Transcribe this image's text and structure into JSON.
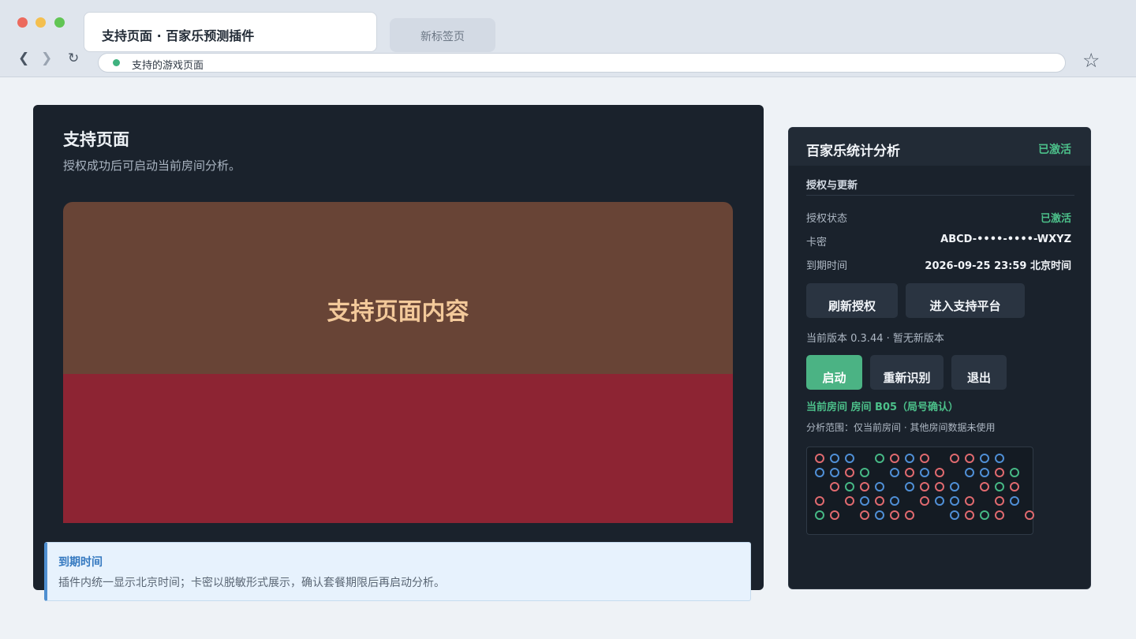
{
  "browser": {
    "active_tab": "支持页面 · 百家乐预测插件",
    "inactive_tab": "新标签页",
    "back_glyph": "❮",
    "forward_glyph": "❯",
    "reload_glyph": "↻",
    "address": "支持的游戏页面",
    "star_glyph": "☆"
  },
  "main": {
    "title": "支持页面",
    "subtitle": "授权成功后可启动当前房间分析。",
    "content_label": "支持页面内容"
  },
  "notice": {
    "title": "到期时间",
    "text": "插件内统一显示北京时间；卡密以脱敏形式展示，确认套餐期限后再启动分析。"
  },
  "plugin": {
    "title": "百家乐统计分析",
    "status": "已激活",
    "section_title": "授权与更新",
    "rows": [
      {
        "key": "授权状态",
        "value": "已激活"
      },
      {
        "key": "卡密",
        "value": "ABCD-••••-••••-WXYZ"
      },
      {
        "key": "到期时间",
        "value": "2026-09-25 23:59 北京时间"
      }
    ],
    "refresh_button": "刷新授权",
    "platform_button": "进入支持平台",
    "version_text": "当前版本 0.3.44 · 暂无新版本",
    "start_button": "启动",
    "recognize_button": "重新识别",
    "exit_button": "退出",
    "room_text": "当前房间 房间 B05（局号确认）",
    "scope_text": "分析范围：仅当前房间 · 其他房间数据未使用",
    "roadmap": [
      "RBB.GRBR.RRBB",
      "BBRG.BRBR.BBRG",
      ".RGRB.BRRB.RGR",
      "R.RBRB.RBBR.RB",
      "GR.RBRR..BRGR.R"
    ]
  },
  "colors": {
    "R": "#e06a6f",
    "B": "#4f8fd6",
    "G": "#46b885",
    "accent_green": "#4bb384",
    "notice_blue": "#3579c0"
  }
}
